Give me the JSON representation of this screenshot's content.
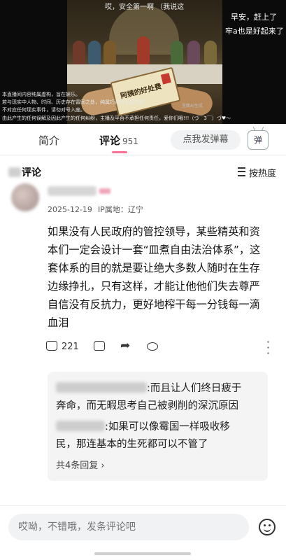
{
  "video": {
    "top_caption": "哎，安全第一啊 （我说这",
    "right_line1": "早安，赶上了",
    "right_line2": "牢a也是好起来了",
    "envelope_label": "阿姨的好处费",
    "watermark": "里面AI生成",
    "disclaimer": [
      "本直播间内容纯属虚构，旨在娱乐。",
      "若与现实中人物、时间、历史存在雷同之处，纯属巧合与子虚乌有。",
      "不对应任何现实事件，请勿对号入座。",
      "由此产生的任何误解及因此产生的任何纠纷，主播及平台不承担任何责任，爱你们哦!!!（づ￣3￣）づ♥～"
    ]
  },
  "tabs": {
    "intro": "简介",
    "comments": "评论",
    "comments_count": "951",
    "danmaku_placeholder": "点我发弹幕",
    "danmaku_toggle": "弹"
  },
  "comments_header": {
    "title_suffix": "评论",
    "sort_label": "按热度"
  },
  "comment": {
    "date": "2025-12-19",
    "ip": "IP属地：辽宁",
    "body": "如果没有人民政府的管控领导，某些精英和资本们一定会设计一套“皿煮自由法治体系”，这套体系的目的就是要让绝大多数人随时在生存边缘挣扎，只有这样，才能让他他们失去尊严自信没有反抗力，更好地榨干每一分钱每一滴血泪",
    "likes": "221"
  },
  "replies": {
    "r1_line1": ":而且让人们终日疲于",
    "r1_line2": "奔命，而无暇思考自己被剥削的深沉原因",
    "r2_line1": ":如果可以像霉国一样吸收移",
    "r2_line2": "民，那连基本的生死都可以不管了",
    "more_label": "共4条回复",
    "more_chevron": "›"
  },
  "input": {
    "placeholder": "哎呦，不错哦，发条评论吧"
  },
  "icons": {
    "more": "more-vertical-icon",
    "emoji": "emoji-icon",
    "share": "share-icon"
  }
}
